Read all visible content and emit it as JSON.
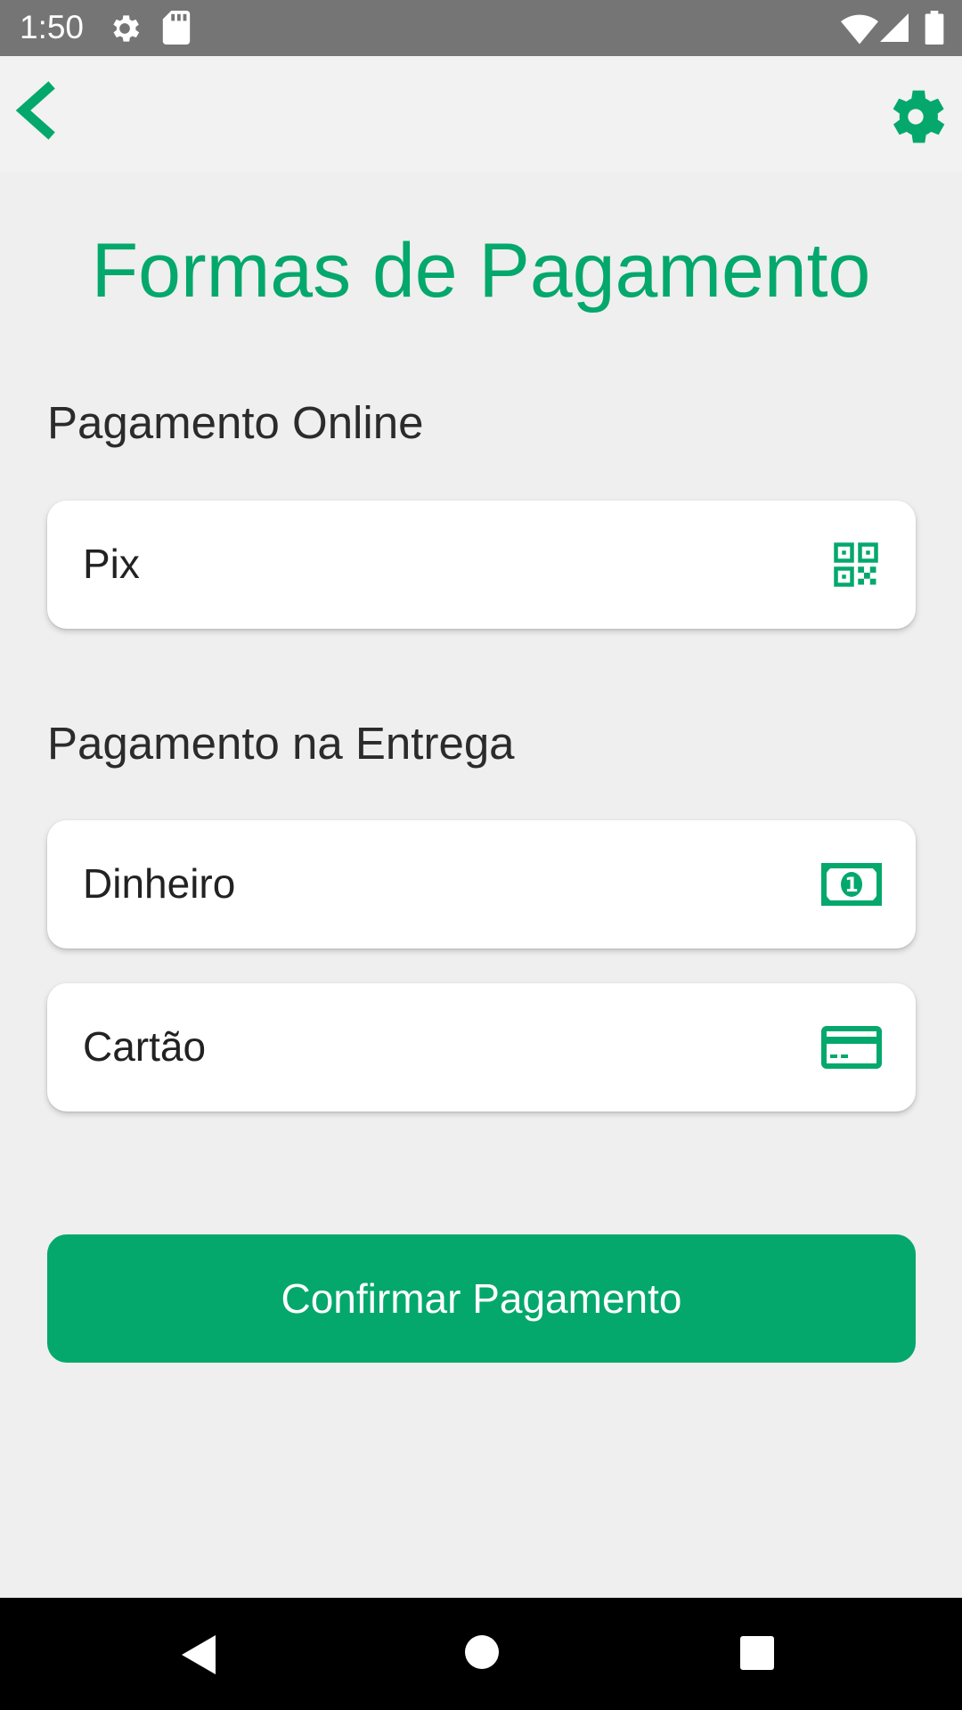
{
  "status_bar": {
    "time": "1:50",
    "icons": [
      "gear-icon",
      "sd-card-icon",
      "wifi-icon",
      "signal-icon",
      "battery-icon"
    ]
  },
  "top_bar": {
    "back_icon": "chevron-left-icon",
    "settings_icon": "gear-icon"
  },
  "page": {
    "title": "Formas de Pagamento"
  },
  "sections": [
    {
      "title": "Pagamento Online",
      "options": [
        {
          "label": "Pix",
          "icon": "qr-code-icon"
        }
      ]
    },
    {
      "title": "Pagamento na Entrega",
      "options": [
        {
          "label": "Dinheiro",
          "icon": "cash-icon"
        },
        {
          "label": "Cartão",
          "icon": "credit-card-icon"
        }
      ]
    }
  ],
  "confirm_button": {
    "label": "Confirmar Pagamento"
  },
  "nav_bar": {
    "icons": [
      "nav-back-icon",
      "nav-home-icon",
      "nav-recents-icon"
    ]
  },
  "colors": {
    "accent": "#04a86c",
    "status_bar": "#757575",
    "background": "#efefef",
    "card": "#ffffff"
  }
}
